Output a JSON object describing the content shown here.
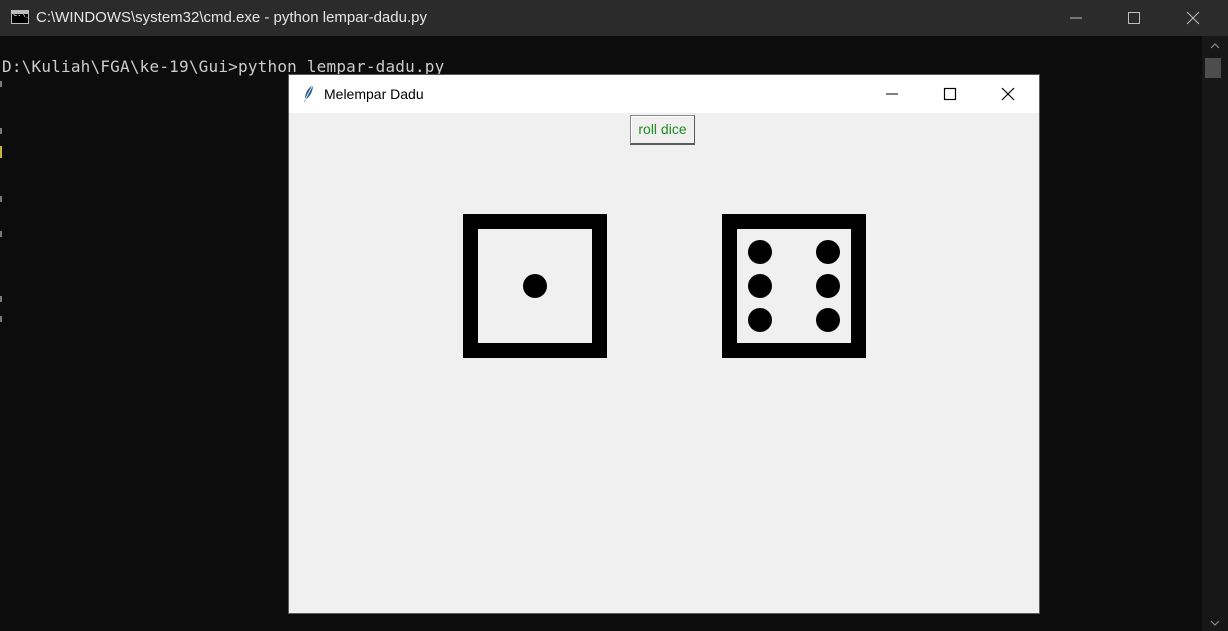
{
  "cmd": {
    "title": "C:\\WINDOWS\\system32\\cmd.exe - python  lempar-dadu.py",
    "icon_text": "C:\\_",
    "console_line": "D:\\Kuliah\\FGA\\ke-19\\Gui>python lempar-dadu.py"
  },
  "tk": {
    "title": "Melempar Dadu",
    "roll_label": "roll dice",
    "roll_color": "#218c21"
  },
  "dice": {
    "left_value": 1,
    "right_value": 6
  }
}
